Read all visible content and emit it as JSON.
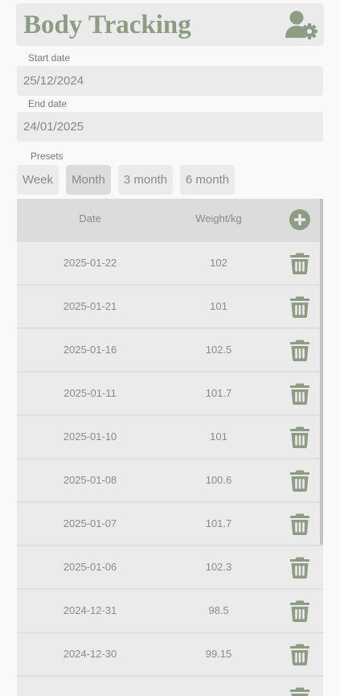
{
  "header": {
    "title": "Body Tracking",
    "settings_icon": "user-gear-icon"
  },
  "start_date": {
    "label": "Start date",
    "value": "25/12/2024"
  },
  "end_date": {
    "label": "End date",
    "value": "24/01/2025"
  },
  "presets": {
    "label": "Presets",
    "selected": "Month",
    "options": [
      "Week",
      "Month",
      "3 month",
      "6 month"
    ]
  },
  "table": {
    "columns": [
      "Date",
      "Weight/kg"
    ],
    "add_icon": "plus-circle-icon",
    "delete_icon": "trash-icon",
    "rows": [
      {
        "date": "2025-01-22",
        "weight": "102"
      },
      {
        "date": "2025-01-21",
        "weight": "101"
      },
      {
        "date": "2025-01-16",
        "weight": "102.5"
      },
      {
        "date": "2025-01-11",
        "weight": "101.7"
      },
      {
        "date": "2025-01-10",
        "weight": "101"
      },
      {
        "date": "2025-01-08",
        "weight": "100.6"
      },
      {
        "date": "2025-01-07",
        "weight": "101.7"
      },
      {
        "date": "2025-01-06",
        "weight": "102.3"
      },
      {
        "date": "2024-12-31",
        "weight": "98.5"
      },
      {
        "date": "2024-12-30",
        "weight": "99.15"
      }
    ]
  },
  "colors": {
    "accent": "#8d9c83",
    "panel": "#ebebeb",
    "selected": "#dcdcdc",
    "text": "#8a8a8a"
  }
}
